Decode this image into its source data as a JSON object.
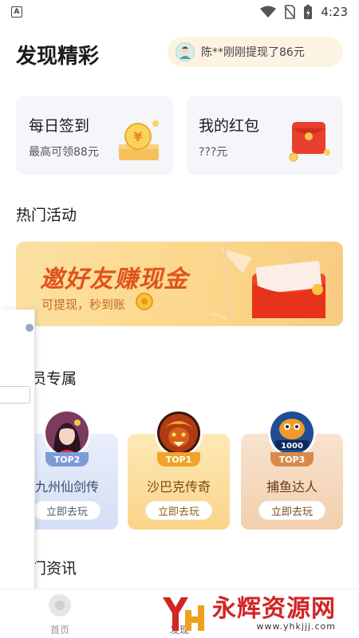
{
  "status_bar": {
    "time": "4:23",
    "app_badge": "A"
  },
  "header": {
    "title": "发现精彩",
    "ticker_text": "陈**刚刚提现了86元"
  },
  "cards": {
    "signin": {
      "title": "每日签到",
      "subtitle": "最高可领88元"
    },
    "redpacket": {
      "title": "我的红包",
      "subtitle": "???元"
    }
  },
  "sections": {
    "hot_activities": "热门活动",
    "member_exclusive": "会员专属",
    "hot_news": "热门资讯"
  },
  "banner": {
    "title": "邀好友赚现金",
    "subtitle": "可提现，秒到账"
  },
  "games": [
    {
      "name": "九州仙剑传",
      "rank": "TOP2",
      "button": "立即去玩"
    },
    {
      "name": "沙巴克传奇",
      "rank": "TOP1",
      "button": "立即去玩"
    },
    {
      "name": "捕鱼达人",
      "rank": "TOP3",
      "button": "立即去玩"
    }
  ],
  "game_icon_text": {
    "fish_score": "1000"
  },
  "bottom_nav": {
    "home_label": "首页",
    "discover_label": "发现"
  },
  "watermark": {
    "brand": "永辉资源网",
    "url": "www.yhkjjj.com"
  },
  "colors": {
    "banner_title": "#e0541c",
    "ticker_bg": "#fdf3e3",
    "card_bg": "#f4f6f9",
    "watermark_red": "#d32424"
  }
}
